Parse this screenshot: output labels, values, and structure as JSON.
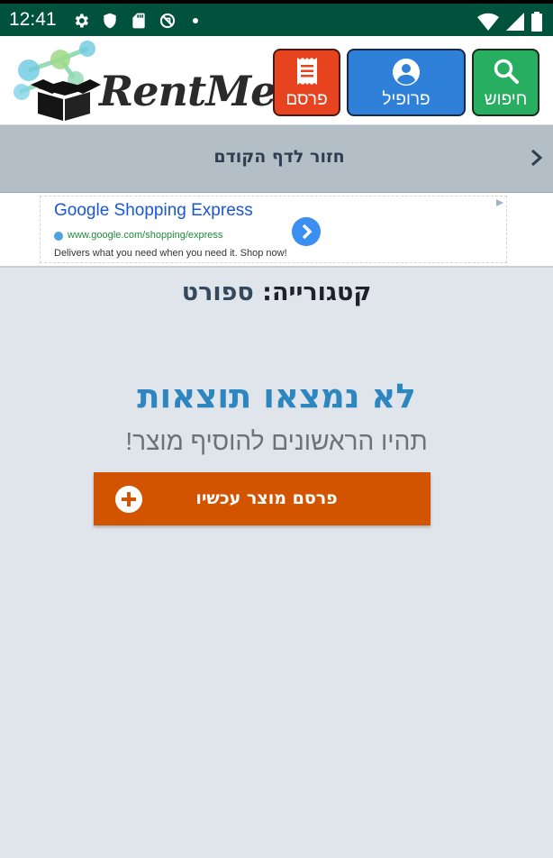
{
  "status_bar": {
    "time": "12:41",
    "left_icons": [
      "settings-icon",
      "shield-icon",
      "sd-card-icon",
      "no-sync-icon",
      "dot-icon"
    ],
    "right_icons": [
      "wifi-icon",
      "cell-signal-icon",
      "battery-icon"
    ]
  },
  "header": {
    "logo_text": "RentMe",
    "buttons": {
      "search": {
        "label": "חיפוש",
        "icon": "search-icon",
        "color": "#27ae60"
      },
      "profile": {
        "label": "פרופיל",
        "icon": "account-circle-icon",
        "color": "#2f80d9"
      },
      "post": {
        "label": "פרסם",
        "icon": "receipt-icon",
        "color": "#e8431f"
      }
    }
  },
  "back_bar": {
    "label": "חזור לדף הקודם",
    "icon": "chevron-right-icon"
  },
  "ad": {
    "title": "Google Shopping Express",
    "url": "www.google.com/shopping/express",
    "description": "Delivers what you need when you need it. Shop now!"
  },
  "main": {
    "category_prefix": "קטגורייה:",
    "category_value": "ספורט",
    "no_results": "לא נמצאו תוצאות",
    "be_first": "תהיו הראשונים להוסיף מוצר!",
    "cta_label": "פרסם מוצר עכשיו",
    "cta_icon": "plus-circle-icon",
    "cta_color": "#d35400"
  }
}
